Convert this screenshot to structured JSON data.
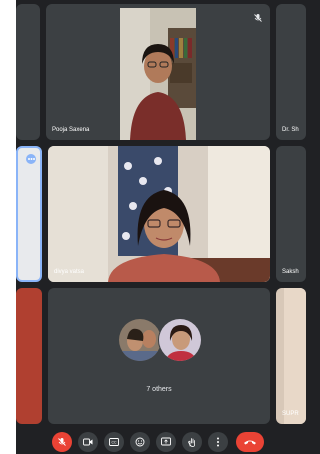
{
  "participants": [
    {
      "name": "Pooja Saxena",
      "muted": true
    },
    {
      "name": "Dr. Sh"
    },
    {
      "name": "divya vatsa",
      "pinned_options": true
    },
    {
      "name": "Saksh"
    },
    {
      "name": "SUPR"
    }
  ],
  "others": {
    "label": "7 others"
  },
  "controls": {
    "mic": {
      "icon": "mic-off-icon",
      "state": "off",
      "color": "#ea4335"
    },
    "camera": {
      "icon": "camera-icon"
    },
    "captions": {
      "icon": "captions-icon",
      "text": "CC"
    },
    "emoji": {
      "icon": "emoji-icon"
    },
    "present": {
      "icon": "present-icon"
    },
    "hand": {
      "icon": "raise-hand-icon"
    },
    "more": {
      "icon": "more-options-icon"
    },
    "hangup": {
      "icon": "hang-up-icon",
      "color": "#ea4335"
    }
  },
  "colors": {
    "background": "#202124",
    "tile": "#3c4043",
    "accent": "#8ab4f8"
  }
}
